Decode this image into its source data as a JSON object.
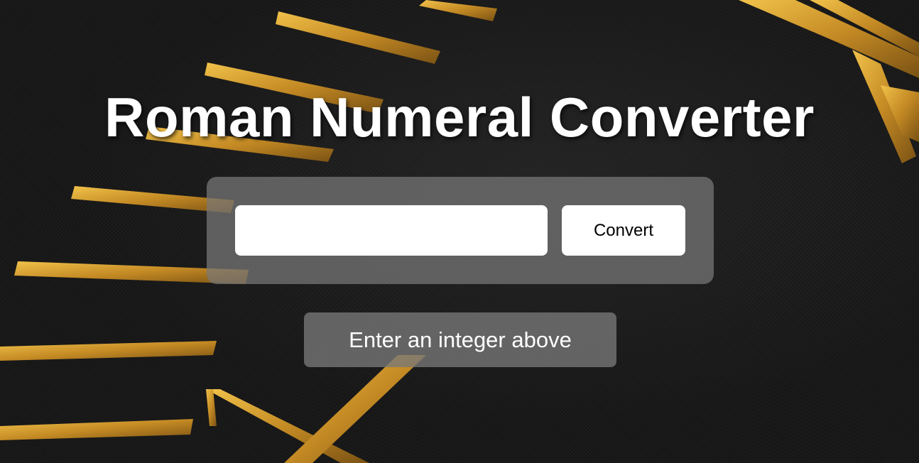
{
  "page": {
    "title": "Roman Numeral Converter"
  },
  "form": {
    "input_value": "",
    "input_placeholder": "",
    "convert_label": "Convert"
  },
  "output": {
    "text": "Enter an integer above"
  },
  "theme": {
    "background": "#161616",
    "gold": "#c9952a",
    "panel": "rgba(120,120,120,0.72)",
    "text": "#ffffff"
  }
}
